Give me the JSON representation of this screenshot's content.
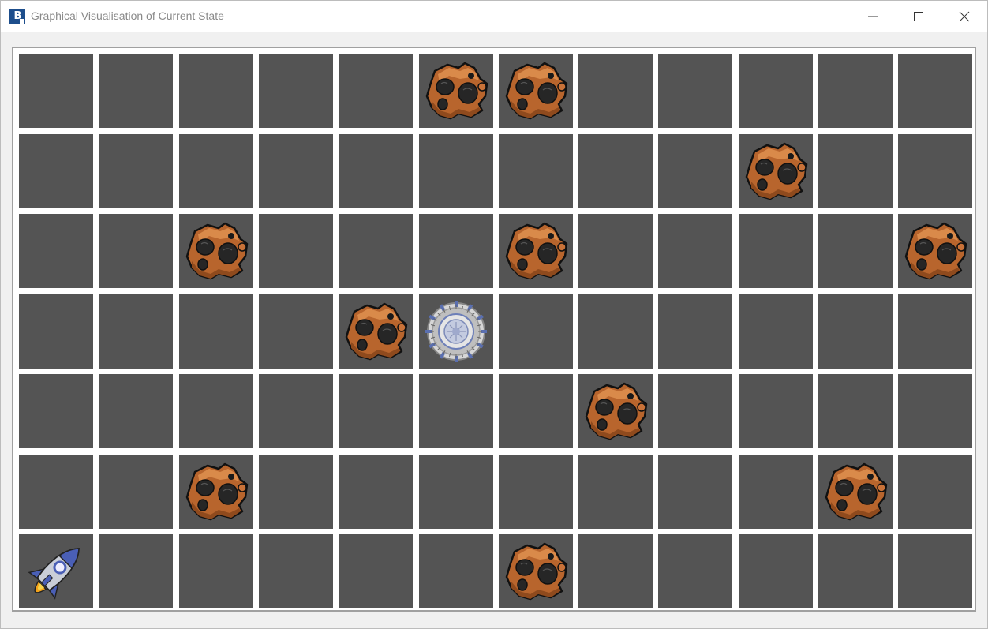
{
  "window": {
    "title": "Graphical Visualisation of Current State",
    "app_icon_text": "B",
    "controls": [
      "minimize",
      "maximize",
      "close"
    ]
  },
  "board": {
    "rows": 7,
    "cols": 12,
    "cell_color": "#545454",
    "gridline_color": "#ffffff",
    "cells": [
      [
        "empty",
        "empty",
        "empty",
        "empty",
        "empty",
        "asteroid",
        "asteroid",
        "empty",
        "empty",
        "empty",
        "empty",
        "empty"
      ],
      [
        "empty",
        "empty",
        "empty",
        "empty",
        "empty",
        "empty",
        "empty",
        "empty",
        "empty",
        "asteroid",
        "empty",
        "empty"
      ],
      [
        "empty",
        "empty",
        "asteroid",
        "empty",
        "empty",
        "empty",
        "asteroid",
        "empty",
        "empty",
        "empty",
        "empty",
        "asteroid"
      ],
      [
        "empty",
        "empty",
        "empty",
        "empty",
        "asteroid",
        "wormhole",
        "empty",
        "empty",
        "empty",
        "empty",
        "empty",
        "empty"
      ],
      [
        "empty",
        "empty",
        "empty",
        "empty",
        "empty",
        "empty",
        "empty",
        "asteroid",
        "empty",
        "empty",
        "empty",
        "empty"
      ],
      [
        "empty",
        "empty",
        "asteroid",
        "empty",
        "empty",
        "empty",
        "empty",
        "empty",
        "empty",
        "empty",
        "asteroid",
        "empty"
      ],
      [
        "rocket",
        "empty",
        "empty",
        "empty",
        "empty",
        "empty",
        "asteroid",
        "empty",
        "empty",
        "empty",
        "empty",
        "empty"
      ]
    ]
  },
  "icons": {
    "asteroid": "asteroid-icon",
    "rocket": "rocket-icon",
    "wormhole": "wormhole-icon"
  }
}
